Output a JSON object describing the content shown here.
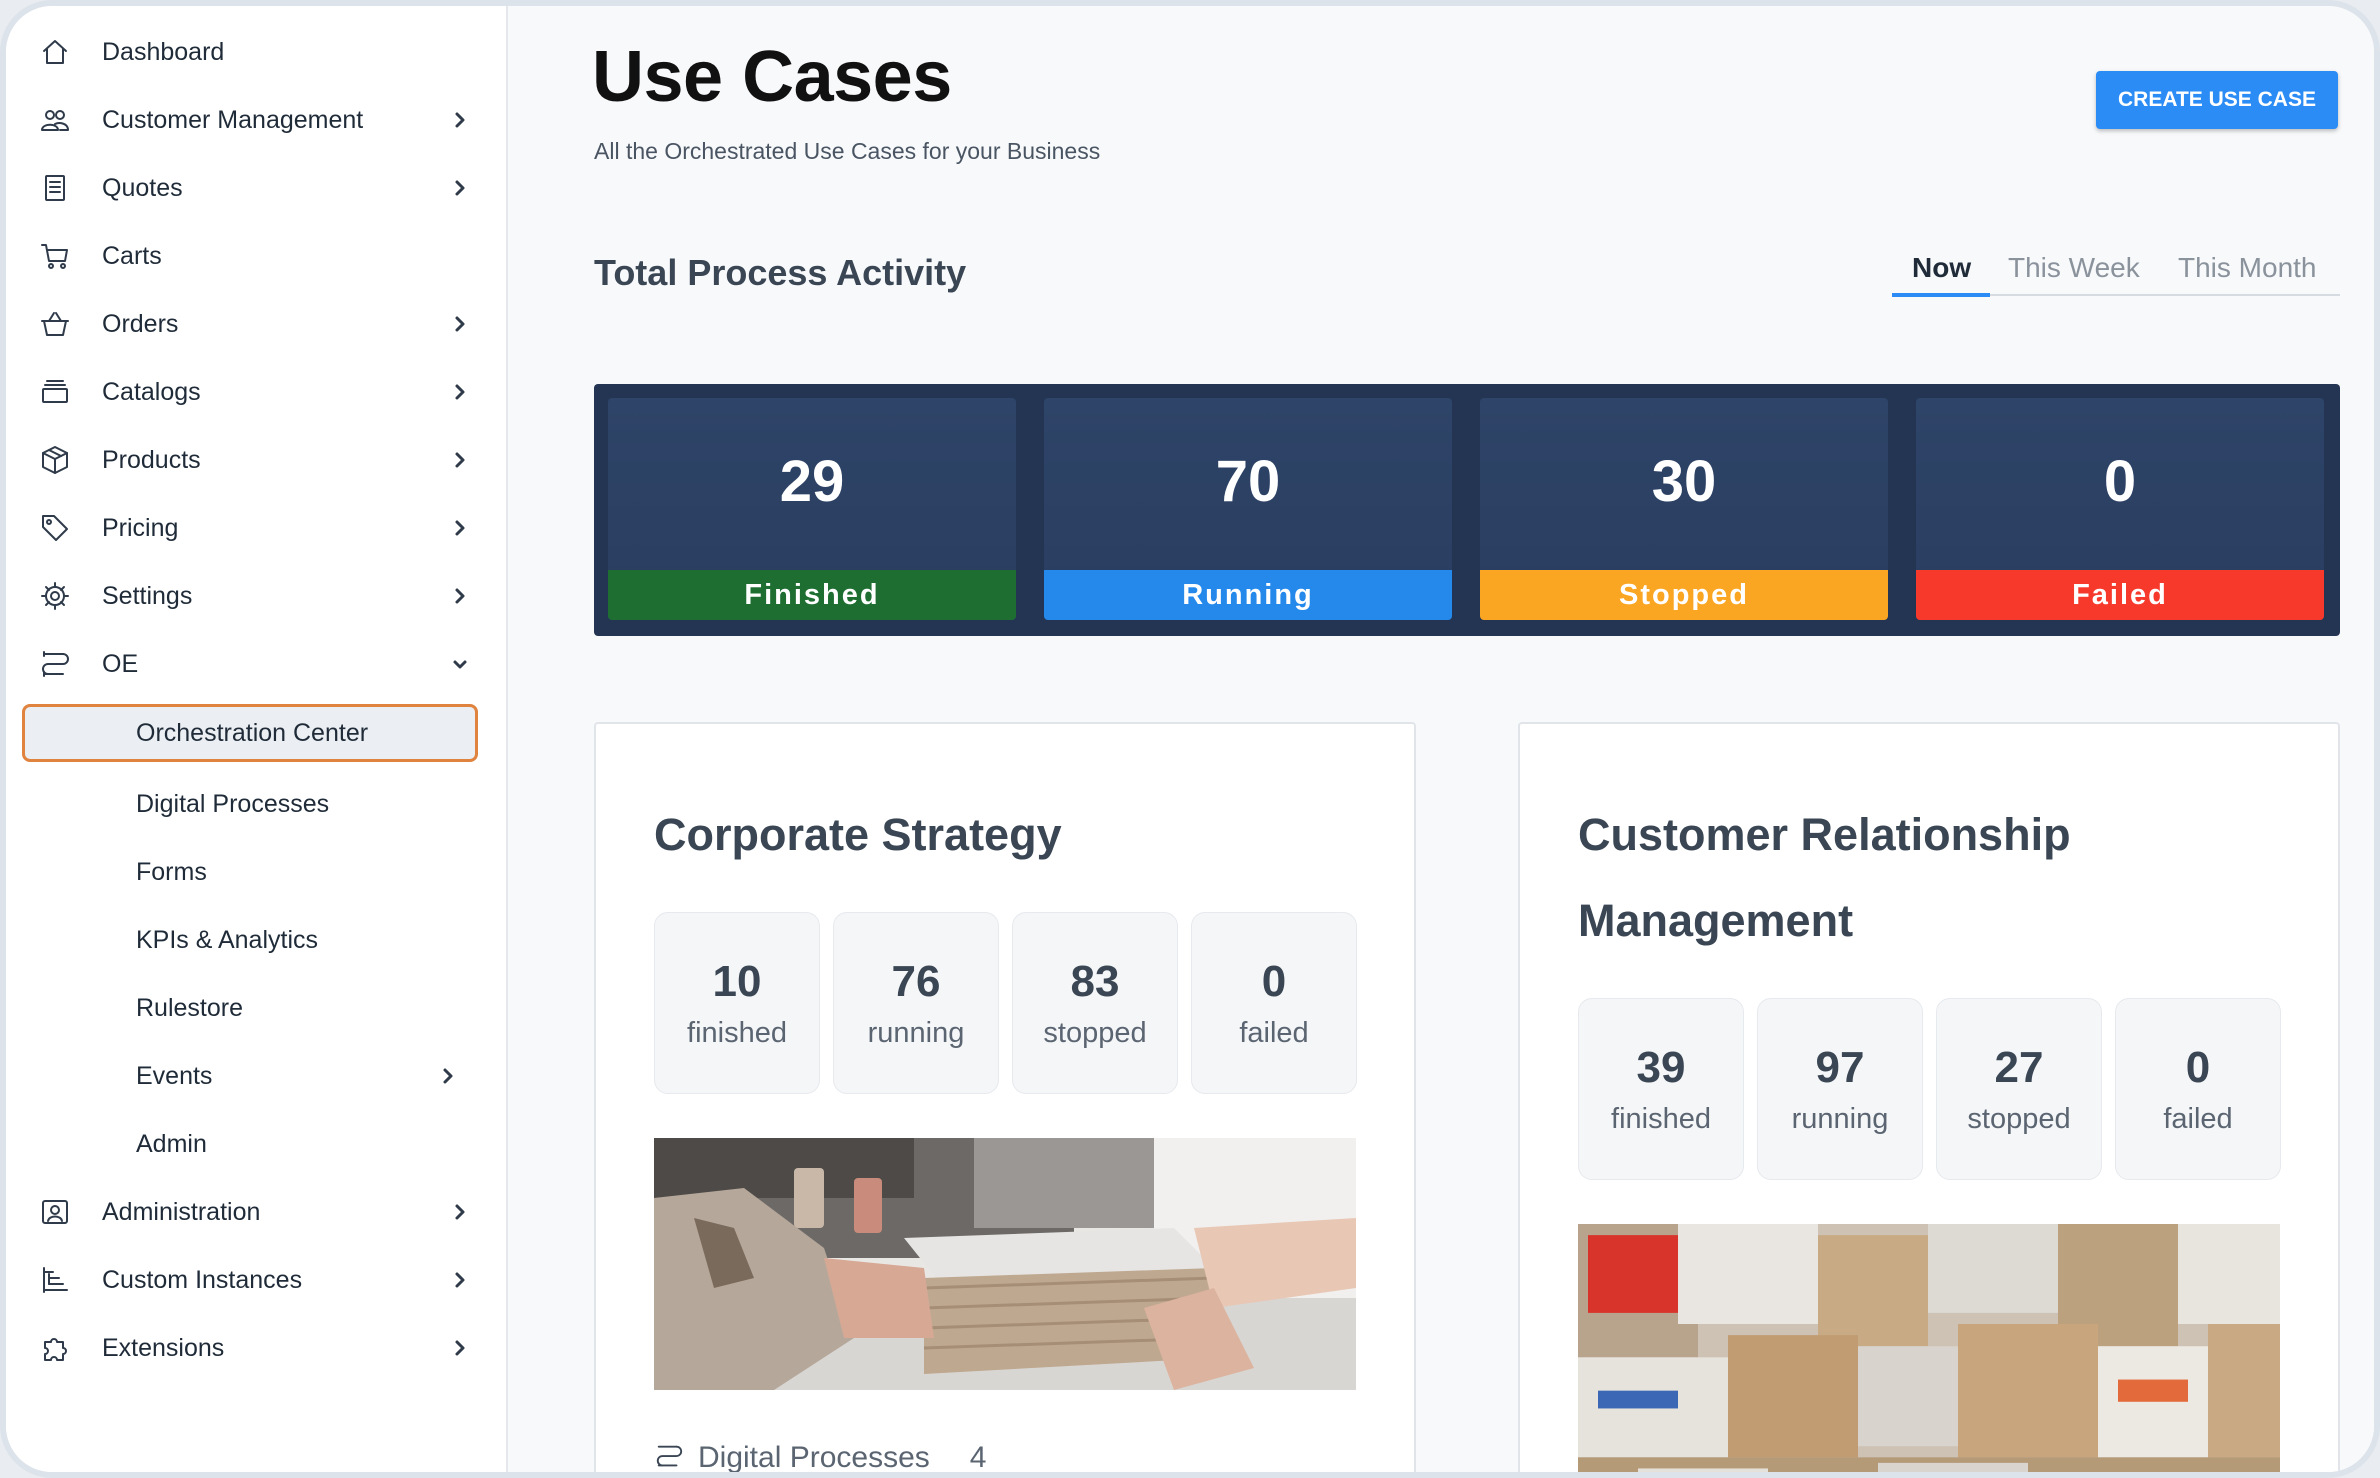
{
  "sidebar": {
    "items": [
      {
        "label": "Dashboard",
        "icon": "home-icon"
      },
      {
        "label": "Customer Management",
        "icon": "users-icon"
      },
      {
        "label": "Quotes",
        "icon": "document-icon"
      },
      {
        "label": "Carts",
        "icon": "cart-icon"
      },
      {
        "label": "Orders",
        "icon": "basket-icon"
      },
      {
        "label": "Catalogs",
        "icon": "layers-icon"
      },
      {
        "label": "Products",
        "icon": "box-icon"
      },
      {
        "label": "Pricing",
        "icon": "tag-icon"
      },
      {
        "label": "Settings",
        "icon": "gear-icon"
      },
      {
        "label": "OE",
        "icon": "flow-icon"
      }
    ],
    "oe_subitems": [
      {
        "label": "Orchestration Center",
        "active": true
      },
      {
        "label": "Digital Processes"
      },
      {
        "label": "Forms"
      },
      {
        "label": "KPIs & Analytics"
      },
      {
        "label": "Rulestore"
      },
      {
        "label": "Events"
      },
      {
        "label": "Admin"
      }
    ],
    "bottom_items": [
      {
        "label": "Administration",
        "icon": "admin-icon"
      },
      {
        "label": "Custom Instances",
        "icon": "tree-icon"
      },
      {
        "label": "Extensions",
        "icon": "puzzle-icon"
      }
    ]
  },
  "header": {
    "title": "Use Cases",
    "subtitle": "All the Orchestrated Use Cases for your Business",
    "create_label": "CREATE USE CASE"
  },
  "activity": {
    "title": "Total Process Activity",
    "tabs": [
      "Now",
      "This Week",
      "This Month"
    ],
    "active_tab": "Now",
    "stats": [
      {
        "value": "29",
        "label": "Finished",
        "color": "#1e6e32"
      },
      {
        "value": "70",
        "label": "Running",
        "color": "#2589ec"
      },
      {
        "value": "30",
        "label": "Stopped",
        "color": "#fba622"
      },
      {
        "value": "0",
        "label": "Failed",
        "color": "#f7392c"
      }
    ]
  },
  "use_cases": [
    {
      "title": "Corporate Strategy",
      "stats": [
        {
          "value": "10",
          "label": "finished"
        },
        {
          "value": "76",
          "label": "running"
        },
        {
          "value": "83",
          "label": "stopped"
        },
        {
          "value": "0",
          "label": "failed"
        }
      ],
      "footer_label": "Digital Processes",
      "footer_count": "4"
    },
    {
      "title": "Customer Relationship Management",
      "stats": [
        {
          "value": "39",
          "label": "finished"
        },
        {
          "value": "97",
          "label": "running"
        },
        {
          "value": "27",
          "label": "stopped"
        },
        {
          "value": "0",
          "label": "failed"
        }
      ]
    }
  ],
  "colors": {
    "accent": "#2b8cf5",
    "panel": "#233553",
    "active_outline": "#e0833f"
  }
}
